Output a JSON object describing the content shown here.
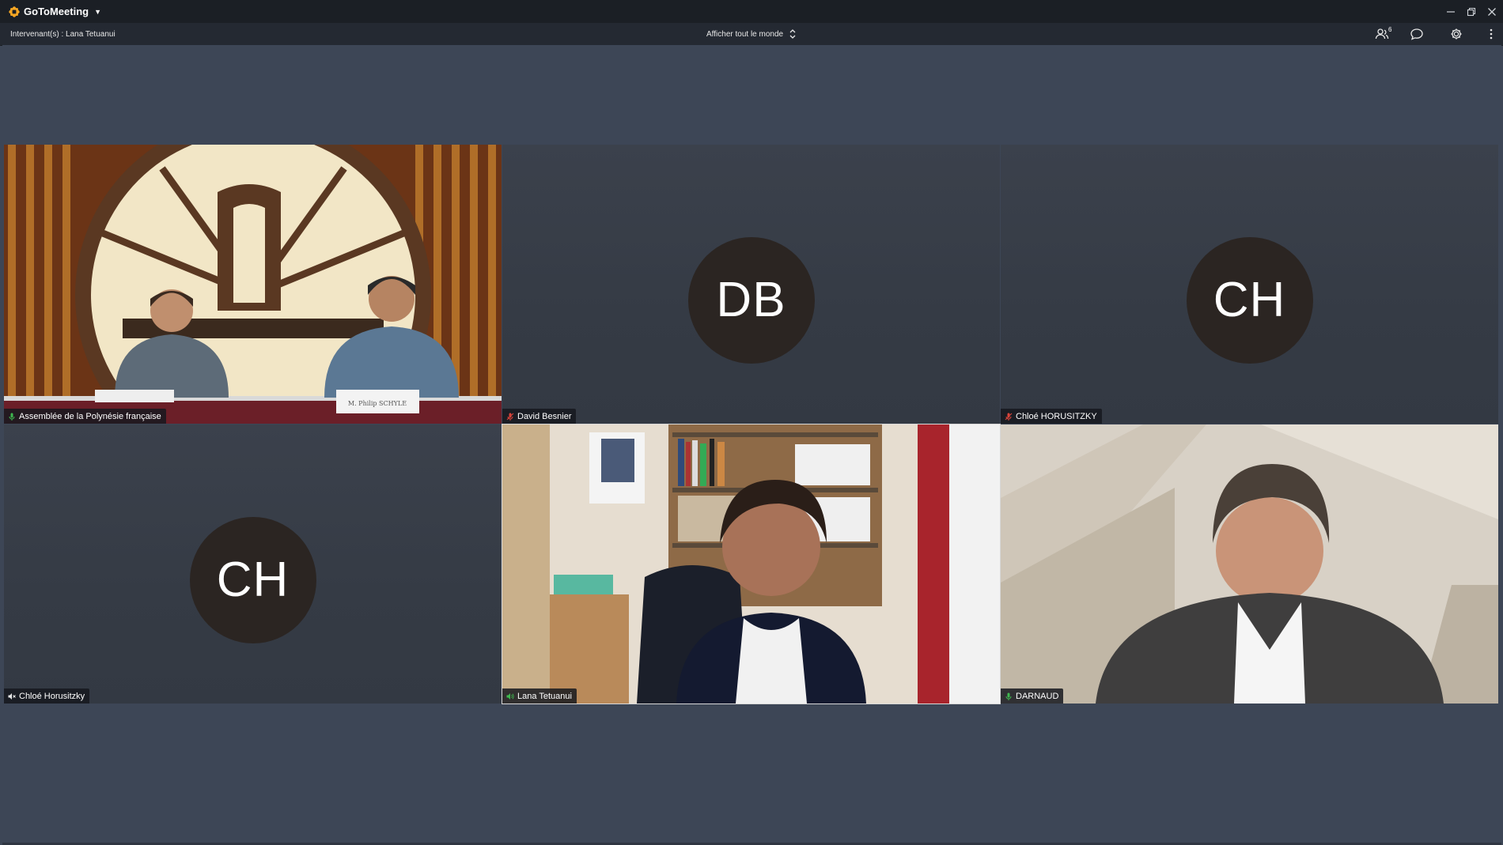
{
  "app": {
    "name": "GoToMeeting",
    "icon": "gotomeeting-logo-icon"
  },
  "infobar": {
    "speaker_text": "Intervenant(s) : Lana Tetuanui",
    "view_label": "Afficher tout le monde",
    "participants_count": "6"
  },
  "tiles": [
    {
      "name": "Assemblée de la Polynésie française",
      "type": "video",
      "mic": "on"
    },
    {
      "name": "David Besnier",
      "type": "avatar",
      "initials": "DB",
      "mic": "muted"
    },
    {
      "name": "Chloé HORUSITZKY",
      "type": "avatar",
      "initials": "CH",
      "mic": "muted"
    },
    {
      "name": "Chloé Horusitzky",
      "type": "avatar",
      "initials": "CH",
      "mic": "speaker-off"
    },
    {
      "name": "Lana Tetuanui",
      "type": "video",
      "mic": "speaking"
    },
    {
      "name": "DARNAUD",
      "type": "video",
      "mic": "on"
    }
  ],
  "video_labels": {
    "nameplate_right": "M. Philip SCHYLE"
  },
  "colors": {
    "mic_on": "#3fb84f",
    "mic_muted": "#d9443a",
    "brand": "#f5a623"
  }
}
